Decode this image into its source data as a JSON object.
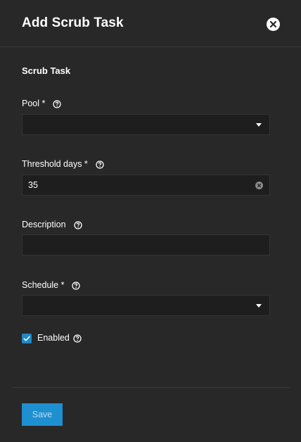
{
  "header": {
    "title": "Add Scrub Task",
    "close_icon": "close-circle-icon"
  },
  "form": {
    "section_title": "Scrub Task",
    "pool": {
      "label": "Pool *",
      "value": ""
    },
    "threshold_days": {
      "label": "Threshold days *",
      "value": "35"
    },
    "description": {
      "label": "Description",
      "value": ""
    },
    "schedule": {
      "label": "Schedule *",
      "value": ""
    },
    "enabled": {
      "label": "Enabled",
      "checked": true
    }
  },
  "footer": {
    "save_label": "Save"
  },
  "colors": {
    "background": "#282828",
    "input_background": "#1e1e1e",
    "accent": "#1e8fd0",
    "checkbox": "#1e88c9"
  }
}
